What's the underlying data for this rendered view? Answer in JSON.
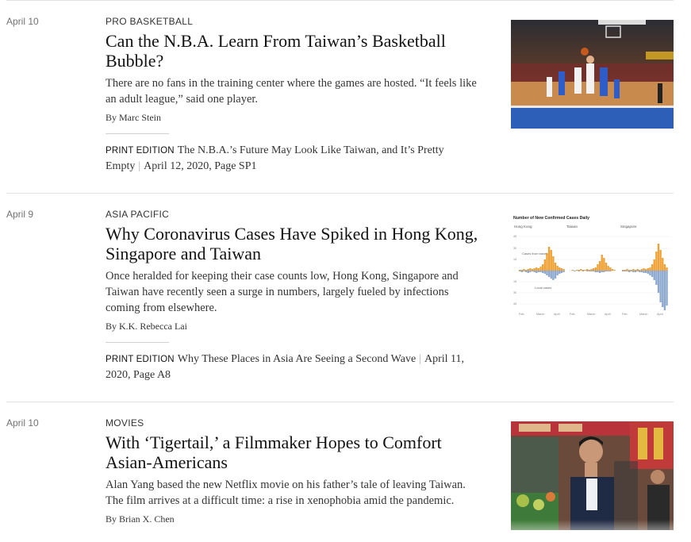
{
  "stories": [
    {
      "date": "April 10",
      "kicker": "Pro Basketball",
      "headline": "Can the N.B.A. Learn From Taiwan’s Basketball Bubble?",
      "summary": "There are no fans in the training center where the games are hosted. “It feels like an adult league,” said one player.",
      "byline": "By Marc Stein",
      "print_label": "Print Edition",
      "print_title": "The N.B.A.’s Future May Look Like Taiwan, and It’s Pretty Empty",
      "print_date": "April 12, 2020, Page SP1"
    },
    {
      "date": "April 9",
      "kicker": "Asia Pacific",
      "headline": "Why Coronavirus Cases Have Spiked in Hong Kong, Singapore and Taiwan",
      "summary": "Once heralded for keeping their case counts low, Hong Kong, Singapore and Taiwan have recently seen a surge in numbers, largely fueled by infections coming from elsewhere.",
      "byline": "By K.K. Rebecca Lai",
      "print_label": "Print Edition",
      "print_title": "Why These Places in Asia Are Seeing a Second Wave",
      "print_date": "April 11, 2020, Page A8",
      "thumb_chart": {
        "title": "Number of New Confirmed Cases Daily",
        "panels": [
          "Hong Kong",
          "Taiwan",
          "Singapore"
        ],
        "label_travel": "Cases from travel",
        "label_local": "Local cases",
        "y_ticks": [
          "45",
          "30",
          "15",
          "15",
          "30",
          "45"
        ],
        "x_ticks": [
          "Feb.",
          "March",
          "April"
        ]
      }
    },
    {
      "date": "April 10",
      "kicker": "Movies",
      "headline": "With ‘Tigertail,’ a Filmmaker Hopes to Comfort Asian-Americans",
      "summary": "Alan Yang based the new Netflix movie on his father’s tale of leaving Taiwan. The film arrives at a difficult time: a rise in xenophobia amid the pandemic.",
      "byline": "By Brian X. Chen"
    }
  ],
  "colors": {
    "rule": "#e2e2e2",
    "travel_orange": "#f0a237",
    "local_blue": "#8ea9cf"
  }
}
